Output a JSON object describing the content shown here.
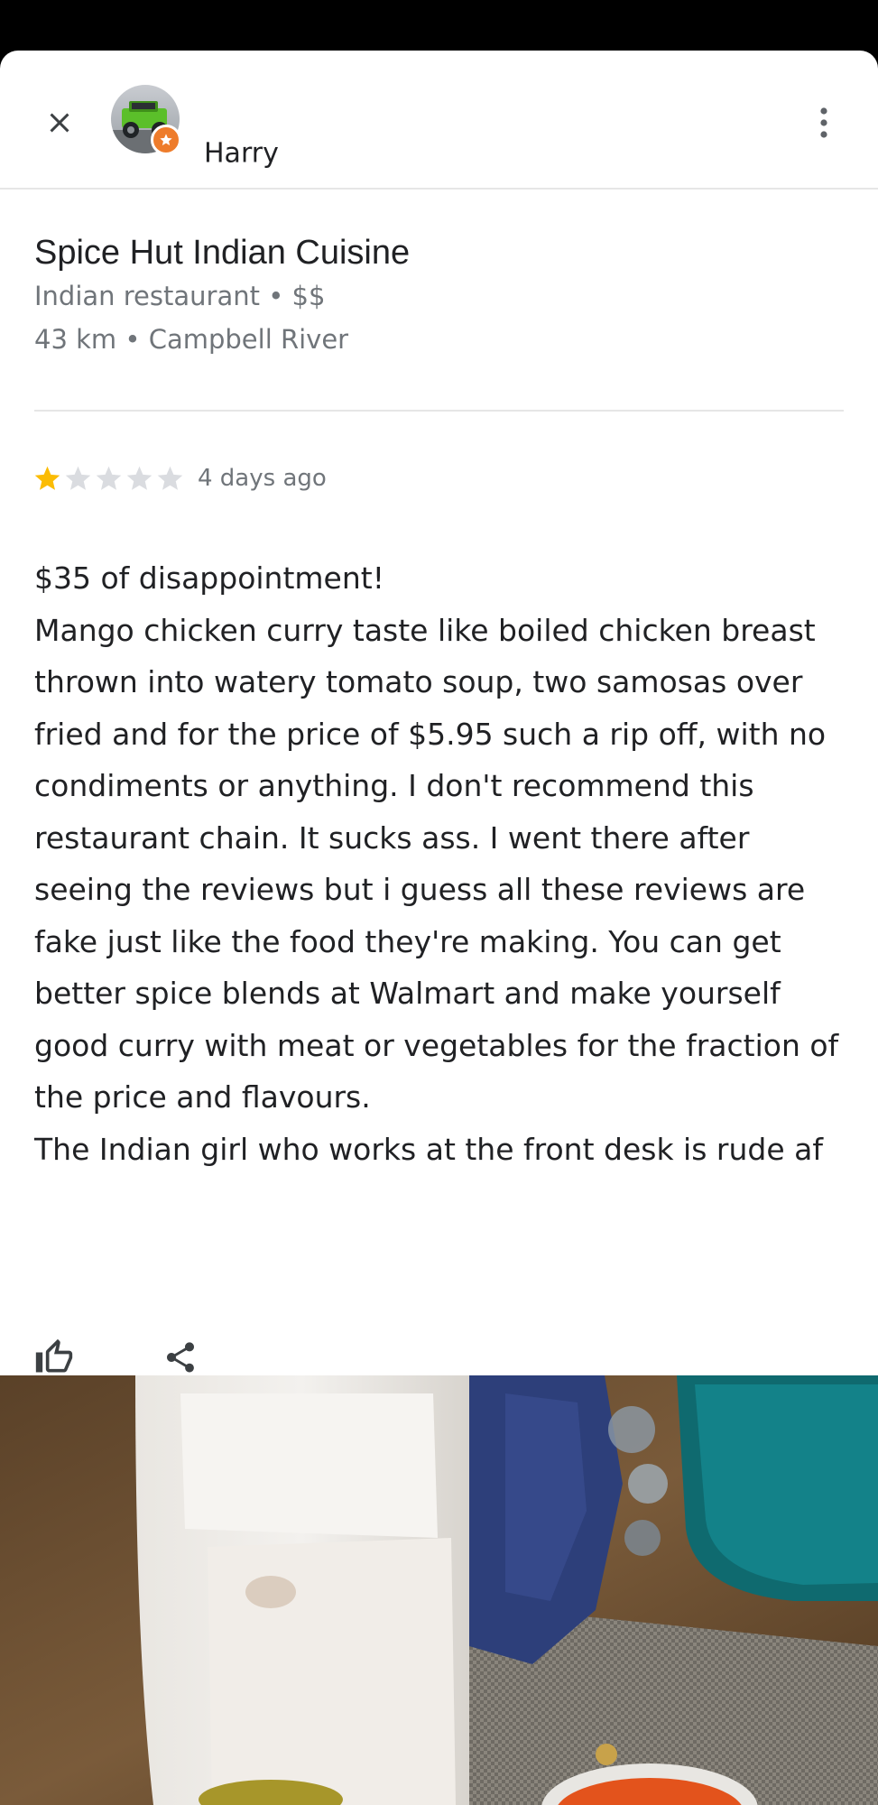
{
  "header": {
    "author_name": "Harry",
    "close_icon": "close-icon",
    "more_icon": "more-vert-icon",
    "badge_icon": "local-guide-star-icon",
    "badge_color": "#ee7c2b"
  },
  "place": {
    "name": "Spice Hut Indian Cuisine",
    "category_price": "Indian restaurant • $$",
    "distance_city": "43 km • Campbell River"
  },
  "review": {
    "rating": 1,
    "max_rating": 5,
    "star_color": "#fbbc04",
    "empty_star_color": "#dadce0",
    "date": "4 days ago",
    "text": "$35 of disappointment!\nMango chicken curry taste like boiled chicken breast thrown into watery tomato soup, two samosas over fried and for the price of $5.95 such a rip off, with no condiments or anything. I don't recommend this restaurant chain. It sucks ass. I went there after seeing the reviews but i guess all these reviews are fake just like the food they're making. You can get better spice blends at Walmart and make yourself good curry with meat or vegetables for the fraction of the price and flavours.\nThe Indian girl who works at the front desk is rude af"
  },
  "actions": {
    "like_icon": "thumb-up-icon",
    "share_icon": "share-icon"
  },
  "photo": {
    "subject": "review-photo-takeout-food"
  }
}
